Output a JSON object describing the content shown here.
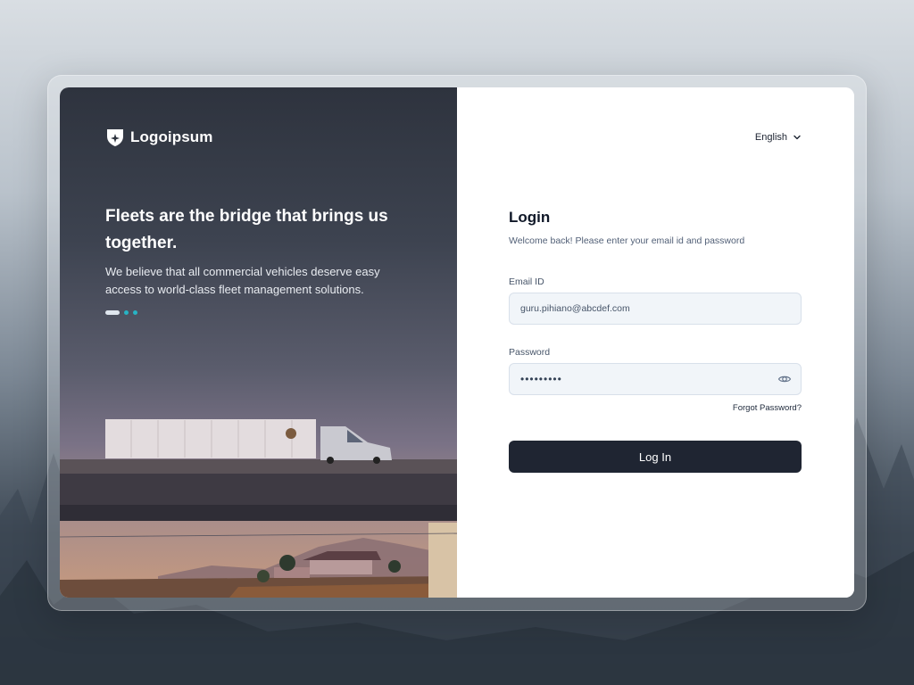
{
  "brand": {
    "name": "Logoipsum",
    "logo_icon": "shield-star-icon"
  },
  "hero": {
    "title": "Fleets are the bridge that brings us together.",
    "subtitle": "We believe that all commercial vehicles deserve easy access to world-class fleet management solutions.",
    "carousel": {
      "slides": 3,
      "active_index": 0
    }
  },
  "language": {
    "selected": "English",
    "icon": "chevron-down-icon"
  },
  "login": {
    "title": "Login",
    "subtitle": "Welcome back! Please enter your email id and password",
    "email_label": "Email ID",
    "email_value": "guru.pihiano@abcdef.com",
    "password_label": "Password",
    "password_value": "•••••••••",
    "password_toggle_icon": "eye-icon",
    "forgot_label": "Forgot Password?",
    "submit_label": "Log In"
  },
  "colors": {
    "accent_dot": "#27b3c4",
    "button": "#1f2532"
  }
}
